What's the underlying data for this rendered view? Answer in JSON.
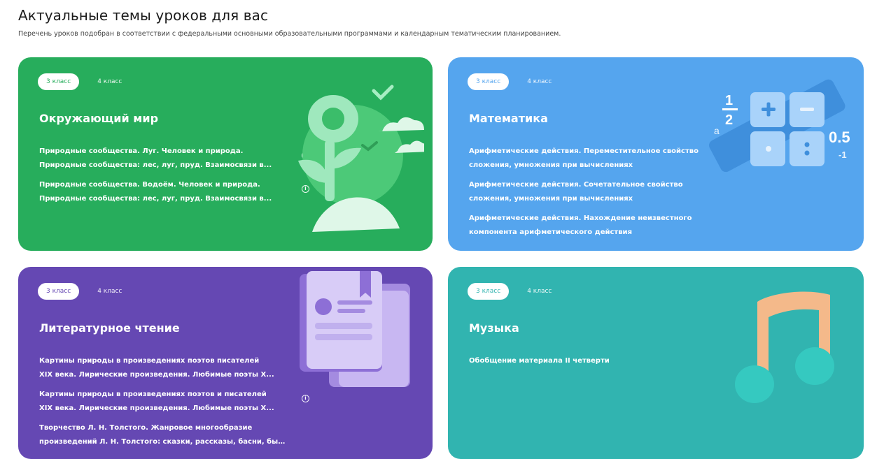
{
  "header": {
    "title": "Актуальные темы уроков для вас",
    "subtitle": "Перечень уроков подобран в соответствии с федеральными основными образовательными программами и календарным тематическим планированием."
  },
  "cards": [
    {
      "subject": "Окружающий мир",
      "tabs": [
        "3 класс",
        "4 класс"
      ],
      "lessons": [
        {
          "l1": "Природные сообщества. Луг. Человек и природа.",
          "l2": "Природные сообщества: лес, луг, пруд. Взаимосвязи в..."
        },
        {
          "l1": "Природные сообщества. Водоём. Человек и природа.",
          "l2": "Природные сообщества: лес, луг, пруд. Взаимосвязи в..."
        }
      ]
    },
    {
      "subject": "Математика",
      "tabs": [
        "3 класс",
        "4 класс"
      ],
      "lessons": [
        {
          "l1": "Арифметические действия. Переместительное свойство",
          "l2": "сложения, умножения при вычислениях"
        },
        {
          "l1": "Арифметические действия. Сочетательное свойство",
          "l2": "сложения, умножения при вычислениях"
        },
        {
          "l1": "Арифметические действия. Нахождение неизвестного",
          "l2": "компонента арифметического действия"
        }
      ],
      "illustration": {
        "n1": "1",
        "n2": "2",
        "a": "a",
        "v1": "0.5",
        "v2": "-1"
      }
    },
    {
      "subject": "Литературное чтение",
      "tabs": [
        "3 класс",
        "4 класс"
      ],
      "lessons": [
        {
          "l1": "Картины природы в произведениях поэтов писателей",
          "l2": "XIX века. Лирические произведения. Любимые поэты X..."
        },
        {
          "l1": "Картины природы в произведениях поэтов и писателей",
          "l2": "XIX века. Лирические произведения. Любимые поэты X..."
        },
        {
          "l1": "Творчество Л. Н. Толстого. Жанровое многообразие",
          "l2": "произведений Л. Н. Толстого: сказки, рассказы, басни, быль"
        }
      ]
    },
    {
      "subject": "Музыка",
      "tabs": [
        "3 класс",
        "4 класс"
      ],
      "lessons": [
        {
          "l1": "Обобщение материала II четверти"
        }
      ]
    }
  ],
  "colors": {
    "green": "#27ad5c",
    "blue": "#55a5ee",
    "purple": "#6548b3",
    "teal": "#31b4b0"
  },
  "icons": {
    "info": "i"
  }
}
